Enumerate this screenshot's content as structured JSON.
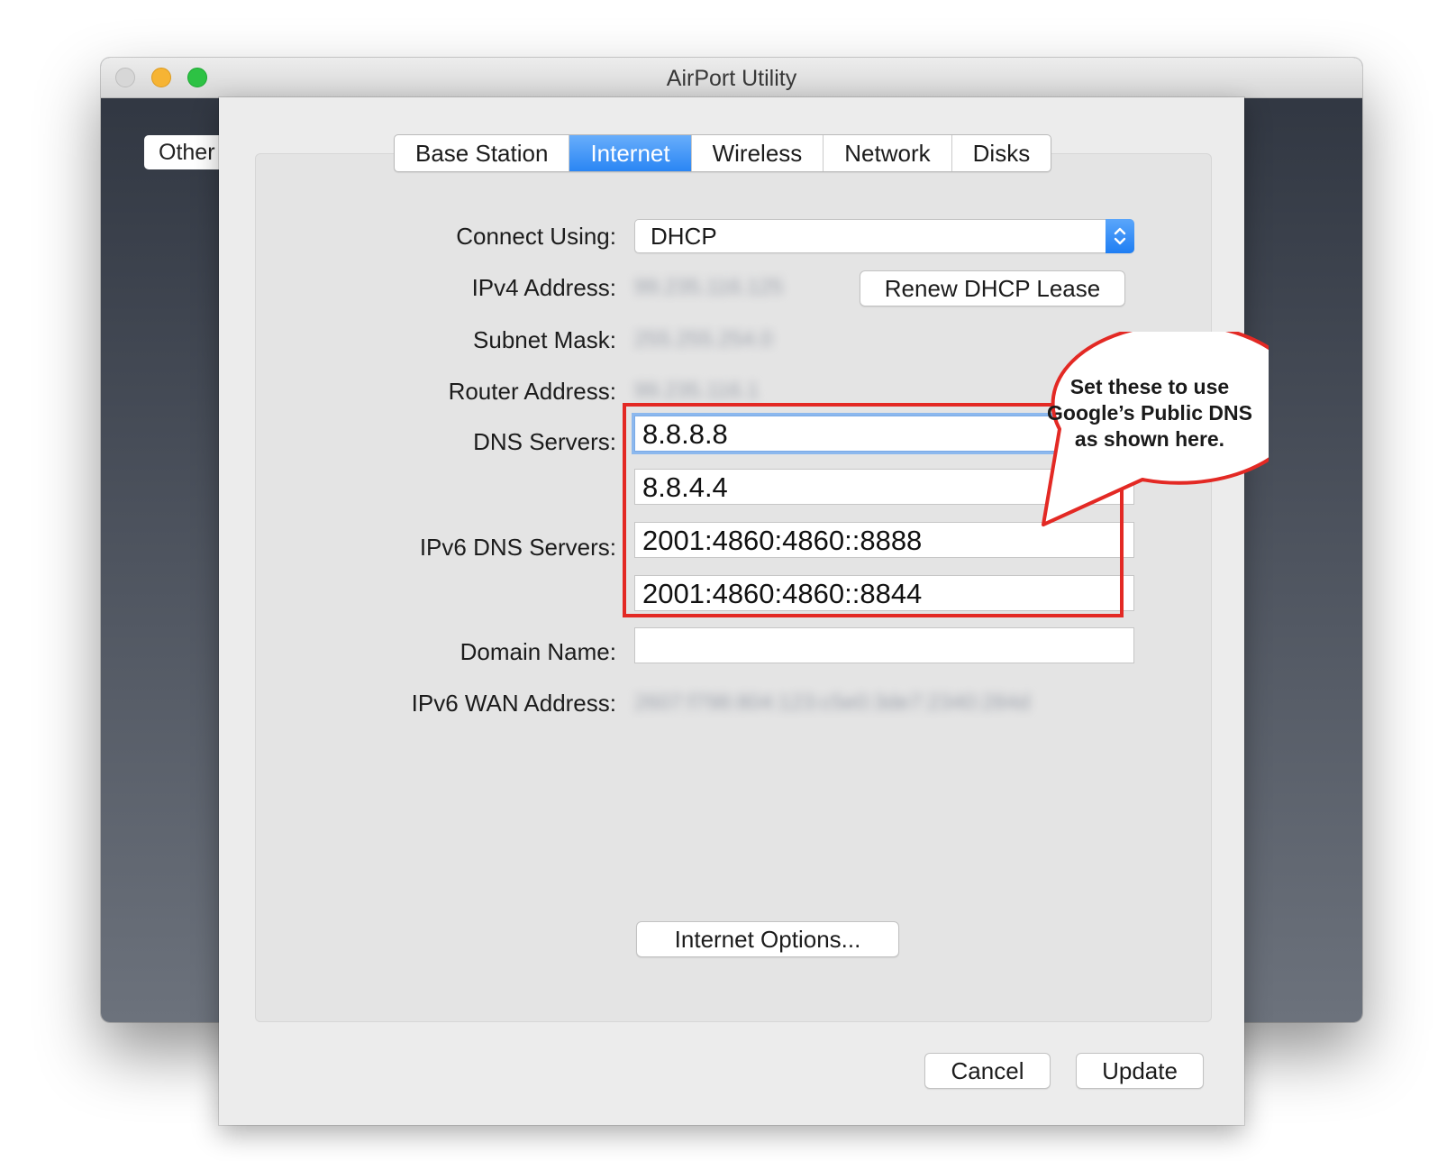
{
  "window": {
    "title": "AirPort Utility"
  },
  "background": {
    "other_button_label": "Other"
  },
  "tabs": [
    {
      "label": "Base Station",
      "active": false
    },
    {
      "label": "Internet",
      "active": true
    },
    {
      "label": "Wireless",
      "active": false
    },
    {
      "label": "Network",
      "active": false
    },
    {
      "label": "Disks",
      "active": false
    }
  ],
  "form": {
    "connect_using_label": "Connect Using:",
    "connect_using_value": "DHCP",
    "ipv4_label": "IPv4 Address:",
    "ipv4_value": "99.235.116.125",
    "renew_button": "Renew DHCP Lease",
    "subnet_label": "Subnet Mask:",
    "subnet_value": "255.255.254.0",
    "router_label": "Router Address:",
    "router_value": "99.235.116.1",
    "dns_label": "DNS Servers:",
    "dns_primary": "8.8.8.8",
    "dns_secondary": "8.8.4.4",
    "ipv6_dns_label": "IPv6 DNS Servers:",
    "ipv6_dns_primary": "2001:4860:4860::8888",
    "ipv6_dns_secondary": "2001:4860:4860::8844",
    "domain_label": "Domain Name:",
    "domain_value": "",
    "ipv6_wan_label": "IPv6 WAN Address:",
    "ipv6_wan_value": "2607:f798:804:123:c5e0:3de7:2340:284d"
  },
  "buttons": {
    "internet_options": "Internet Options...",
    "cancel": "Cancel",
    "update": "Update"
  },
  "annotation": {
    "callout_line_1": "Set these to use",
    "callout_line_2": "Google’s Public DNS",
    "callout_line_3": "as shown here.",
    "highlight_color": "#e32924"
  },
  "colors": {
    "accent": "#2a86f4",
    "traffic_close": "#d7d7d7",
    "traffic_minimize": "#f6b434",
    "traffic_maximize": "#2dc244"
  }
}
